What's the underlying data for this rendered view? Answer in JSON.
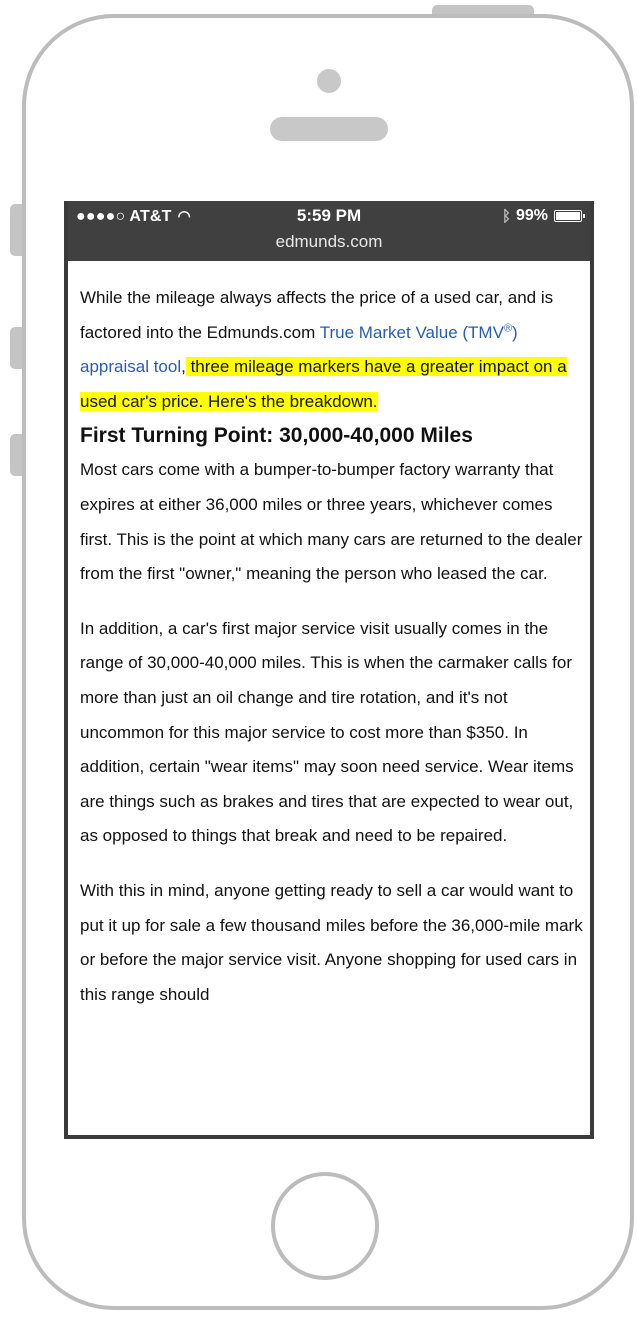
{
  "status_bar": {
    "carrier": "●●●●○ AT&T",
    "time": "5:59 PM",
    "battery": "99%",
    "url": "edmunds.com",
    "icons": [
      "wifi-icon",
      "bluetooth-icon",
      "battery-icon"
    ]
  },
  "article": {
    "intro_text_1": "While the mileage always affects the price of a used car, and is factored into the Edmunds.com ",
    "intro_link_1": "True Market Value (TMV",
    "intro_link_sup": "®",
    "intro_link_2": ") appraisal tool",
    "intro_comma": ",",
    "intro_highlight": " three mileage markers have a greater impact on a used car's price. Here's the breakdown.",
    "heading": "First Turning Point: 30,000-40,000 Miles",
    "para1": "Most cars come with a bumper-to-bumper factory warranty that expires at either 36,000 miles or three years, whichever comes first. This is the point at which many cars are returned to the dealer from the first \"owner,\" meaning the person who leased the car.",
    "para2": "In addition, a car's first major service visit usually comes in the range of 30,000-40,000 miles. This is when the carmaker calls for more than just an oil change and tire rotation, and it's not uncommon for this major service to cost more than $350. In addition, certain \"wear items\" may soon need service. Wear items are things such as brakes and tires that are expected to wear out, as opposed to things that break and need to be repaired.",
    "para3": "With this in mind, anyone getting ready to sell a car would want to put it up for sale a few thousand miles before the 36,000-mile mark or before the major service visit. Anyone shopping for used cars in this range should"
  },
  "colors": {
    "highlight": "#ffff00",
    "link": "#2a5db0",
    "status_bar_bg": "#404040",
    "phone_frame": "#bcbcbc"
  }
}
